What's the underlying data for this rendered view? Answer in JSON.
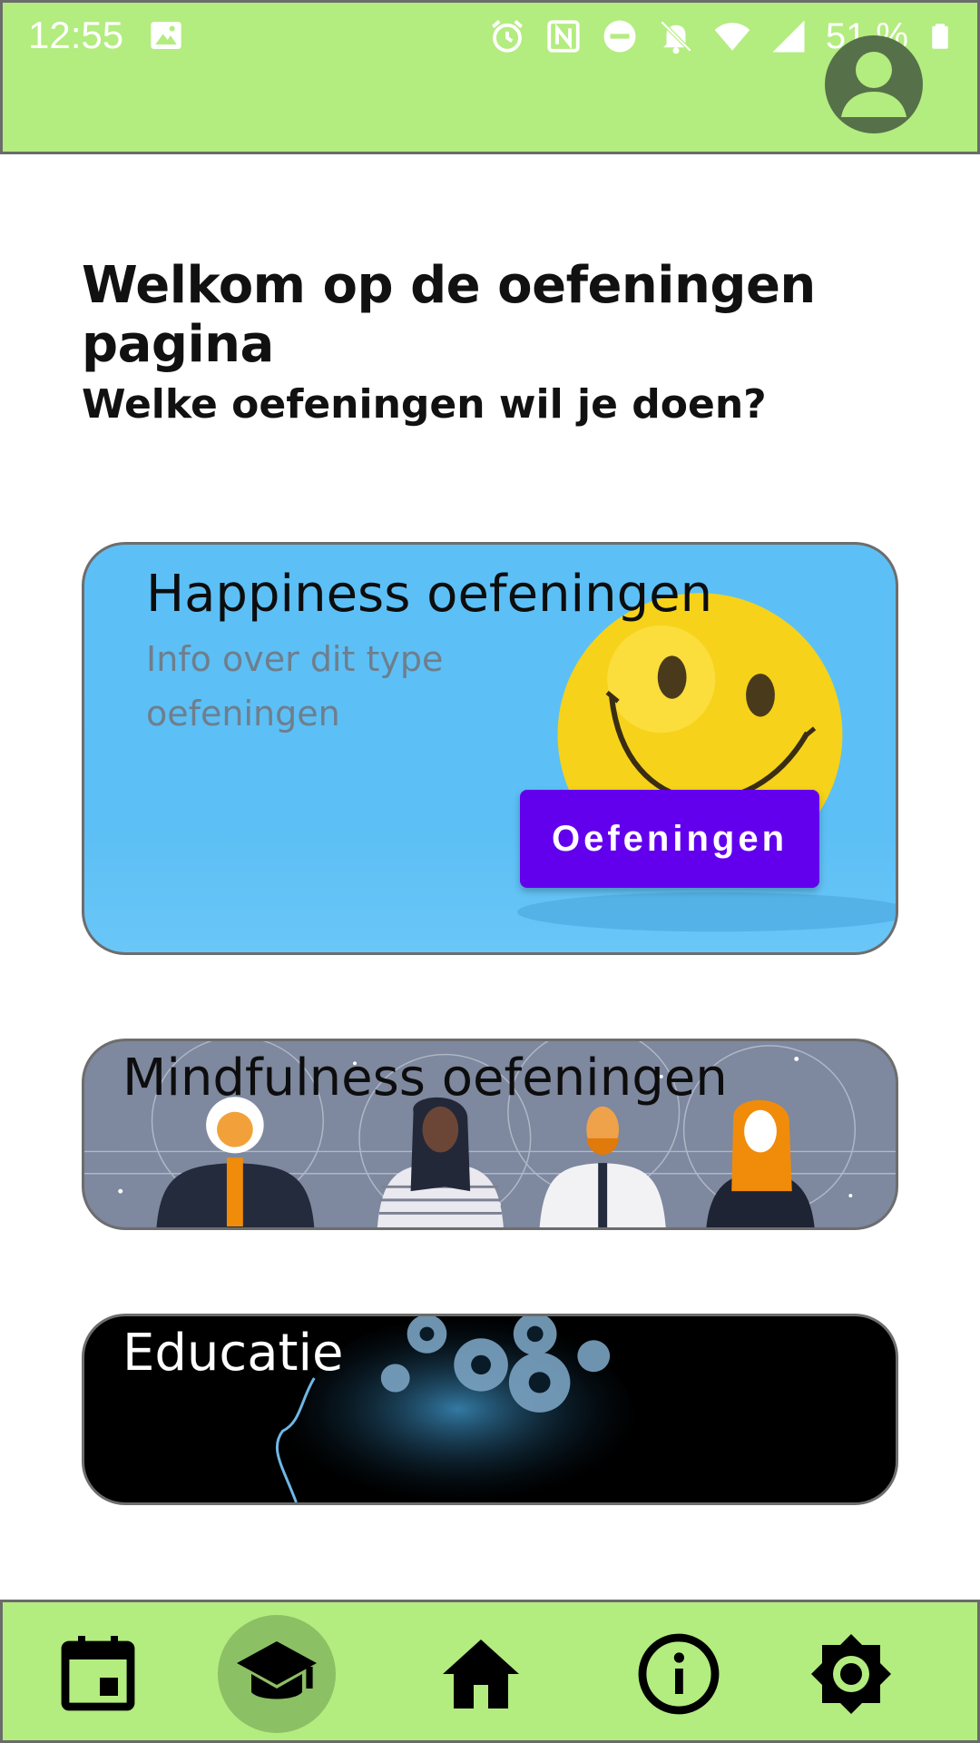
{
  "status_bar": {
    "time": "12:55",
    "battery": "51 %",
    "icons": [
      "image-icon",
      "alarm-icon",
      "nfc-icon",
      "do-not-disturb-icon",
      "bell-off-icon",
      "wifi-icon",
      "signal-icon",
      "battery-icon"
    ]
  },
  "header": {
    "avatar_icon": "account-circle-icon"
  },
  "main": {
    "title": "Welkom op de oefeningen pagina",
    "subtitle": "Welke oefeningen wil je doen?"
  },
  "cards": [
    {
      "title": "Happiness oefeningen",
      "info": "Info over dit type oefeningen",
      "button_label": "Oefeningen"
    },
    {
      "title": "Mindfulness oefeningen"
    },
    {
      "title": "Educatie"
    }
  ],
  "bottom_nav": {
    "items": [
      "calendar-icon",
      "school-icon",
      "home-icon",
      "info-icon",
      "settings-icon"
    ],
    "active_index": 1
  },
  "colors": {
    "bar_green": "#b3ec7f",
    "active_nav": "#8cc064",
    "button_purple": "#6200ee",
    "happiness_bg": "#5cc0f6"
  }
}
